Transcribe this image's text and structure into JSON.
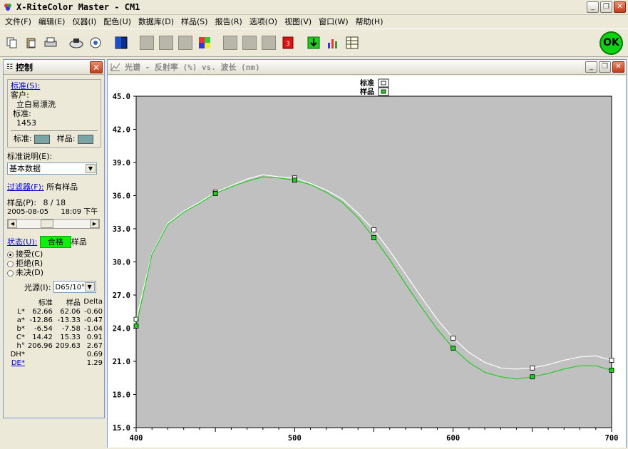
{
  "window": {
    "title": "X-RiteColor Master - CM1"
  },
  "menu": [
    "文件(F)",
    "编辑(E)",
    "仪器(I)",
    "配色(U)",
    "数据库(D)",
    "样品(S)",
    "报告(R)",
    "选项(O)",
    "视图(V)",
    "窗口(W)",
    "帮助(H)"
  ],
  "toolbar": {
    "ok_label": "OK"
  },
  "control": {
    "title": "控制",
    "standard_link": "标准(S):",
    "customer_label": "客户:",
    "customer_value": "立白易漂洗",
    "standard_label": "标准:",
    "standard_value": "1453",
    "swatch_std_label": "标准:",
    "swatch_smp_label": "样品:",
    "std_desc_label": "标准说明(E):",
    "std_desc_value": "基本数据",
    "filter_link": "过滤器(F):",
    "filter_value": "所有样品",
    "sample_label": "样品(P):",
    "sample_pos": "8 / 18",
    "sample_date": "2005-08-05",
    "sample_time": "18:09 下午",
    "status_link": "状态(U):",
    "status_value": "合格",
    "status_suffix": "样品",
    "radio_accept": "接受(C)",
    "radio_reject": "拒绝(R)",
    "radio_pending": "未决(D)",
    "illuminant_label": "光源(I):",
    "illuminant_value": "D65/10°",
    "table_headers": [
      "标准",
      "样品",
      "Delta"
    ],
    "rows": [
      {
        "label": "L*",
        "std": "62.66",
        "smp": "62.06",
        "delta": "-0.60"
      },
      {
        "label": "a*",
        "std": "-12.86",
        "smp": "-13.33",
        "delta": "-0.47"
      },
      {
        "label": "b*",
        "std": "-6.54",
        "smp": "-7.58",
        "delta": "-1.04"
      },
      {
        "label": "C*",
        "std": "14.42",
        "smp": "15.33",
        "delta": "0.91"
      },
      {
        "label": "h°",
        "std": "206.96",
        "smp": "209.63",
        "delta": "2.67"
      },
      {
        "label": "DH*",
        "std": "",
        "smp": "",
        "delta": "0.69"
      },
      {
        "label": "DE*",
        "std": "",
        "smp": "",
        "delta": "1.29"
      }
    ],
    "colors": {
      "swatch": "#7ba5a5",
      "status_ok": "#0cf00c"
    }
  },
  "spectrum": {
    "window_title": "光谱 - 反射率 (%) vs. 波长 (nm)"
  },
  "chart_data": {
    "type": "line",
    "title": "",
    "xlabel": "",
    "ylabel": "",
    "xlim": [
      400,
      700
    ],
    "ylim": [
      15,
      45
    ],
    "x_ticks": [
      400,
      500,
      600,
      700
    ],
    "y_ticks": [
      15.0,
      18.0,
      21.0,
      24.0,
      27.0,
      30.0,
      33.0,
      36.0,
      39.0,
      42.0,
      45.0
    ],
    "legend": [
      {
        "name": "标准",
        "color": "#ffffff"
      },
      {
        "name": "样品",
        "color": "#22cc22"
      }
    ],
    "legend_position": "top-center",
    "x": [
      400,
      410,
      420,
      430,
      440,
      450,
      460,
      470,
      480,
      490,
      500,
      510,
      520,
      530,
      540,
      550,
      560,
      570,
      580,
      590,
      600,
      610,
      620,
      630,
      640,
      650,
      660,
      670,
      680,
      690,
      700
    ],
    "series": [
      {
        "name": "标准",
        "color": "#ffffff",
        "values": [
          24.8,
          30.8,
          33.5,
          34.6,
          35.4,
          36.3,
          36.9,
          37.5,
          37.9,
          37.7,
          37.6,
          37.1,
          36.5,
          35.7,
          34.4,
          32.9,
          31.0,
          28.9,
          26.8,
          24.8,
          23.1,
          21.8,
          20.9,
          20.4,
          20.3,
          20.4,
          20.7,
          21.1,
          21.4,
          21.5,
          21.1
        ]
      },
      {
        "name": "样品",
        "color": "#22cc22",
        "values": [
          24.2,
          30.7,
          33.4,
          34.5,
          35.3,
          36.2,
          36.8,
          37.3,
          37.7,
          37.6,
          37.4,
          37.0,
          36.3,
          35.4,
          34.0,
          32.2,
          30.2,
          28.0,
          25.9,
          23.9,
          22.2,
          20.9,
          20.0,
          19.6,
          19.4,
          19.6,
          19.9,
          20.3,
          20.6,
          20.6,
          20.2
        ]
      }
    ],
    "markers_x": [
      400,
      450,
      500,
      550,
      600,
      650,
      700
    ],
    "colors": {
      "plot_bg": "#c0c0c0",
      "frame_bg": "#ffffff"
    }
  }
}
